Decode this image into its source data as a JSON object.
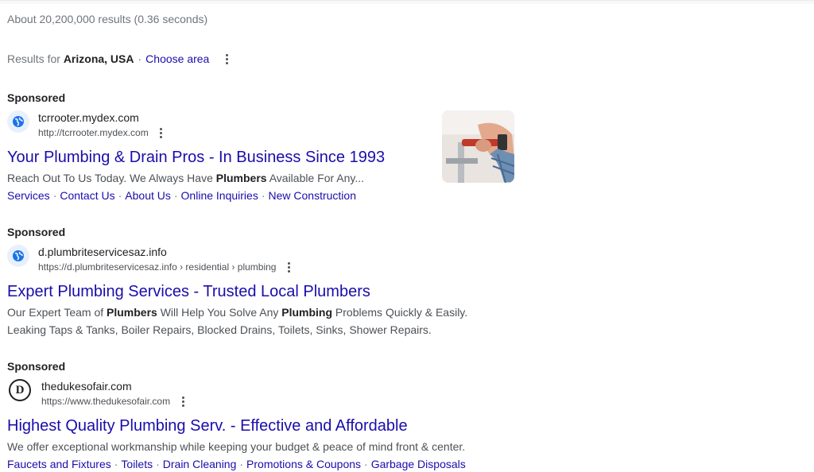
{
  "results_stats": "About 20,200,000 results (0.36 seconds)",
  "location": {
    "prefix": "Results for",
    "place": "Arizona, USA",
    "separator": "·",
    "change_link": "Choose area"
  },
  "ads": [
    {
      "label": "Sponsored",
      "domain": "tcrrooter.mydex.com",
      "url": "http://tcrrooter.mydex.com",
      "title": "Your Plumbing & Drain Pros - In Business Since 1993",
      "desc": [
        "Reach Out To Us Today. We Always Have ",
        "Plumbers",
        " Available For Any..."
      ],
      "links": [
        "Services",
        "Contact Us",
        "About Us",
        "Online Inquiries",
        "New Construction"
      ]
    },
    {
      "label": "Sponsored",
      "domain": "d.plumbriteservicesaz.info",
      "url": "https://d.plumbriteservicesaz.info › residential › plumbing",
      "title": "Expert Plumbing Services - Trusted Local Plumbers",
      "desc": [
        "Our Expert Team of ",
        "Plumbers",
        " Will Help You Solve Any ",
        "Plumbing",
        " Problems Quickly & Easily."
      ],
      "desc2": "Leaking Taps & Tanks, Boiler Repairs, Blocked Drains, Toilets, Sinks, Shower Repairs."
    },
    {
      "label": "Sponsored",
      "favicon_letter": "D",
      "domain": "thedukesofair.com",
      "url": "https://www.thedukesofair.com",
      "title": "Highest Quality Plumbing Serv. - Effective and Affordable",
      "desc": "We offer exceptional workmanship while keeping your budget & peace of mind front & center.",
      "links": [
        "Faucets and Fixtures",
        "Toilets",
        "Drain Cleaning",
        "Promotions & Coupons",
        "Garbage Disposals"
      ]
    }
  ],
  "icons": {
    "globe": "globe-icon",
    "more": "more-vert-icon"
  },
  "colors": {
    "link": "#1a0dab",
    "text": "#202124",
    "muted": "#70757a",
    "favicon_bg": "#e8f0fe",
    "globe": "#1a73e8"
  }
}
